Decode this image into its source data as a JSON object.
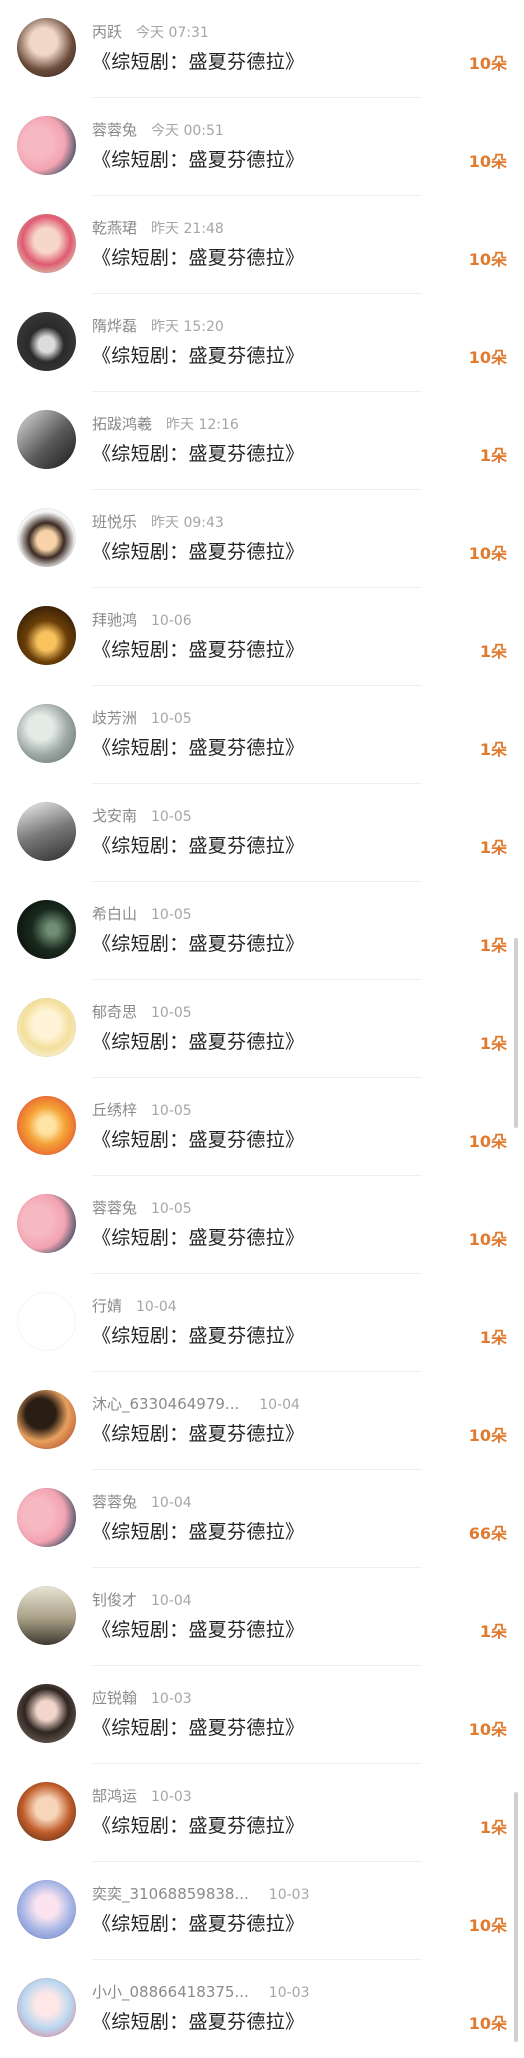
{
  "colors": {
    "accent": "#e07a2f",
    "name_text": "#8a8a8a",
    "title_text": "#222222",
    "divider": "#efefef"
  },
  "items": [
    {
      "name": "丙跃",
      "time": "今天 07:31",
      "title": "《综短剧：盛夏芬德拉》",
      "amount": "10朵"
    },
    {
      "name": "蓉蓉兔",
      "time": "今天 00:51",
      "title": "《综短剧：盛夏芬德拉》",
      "amount": "10朵"
    },
    {
      "name": "乾燕珺",
      "time": "昨天 21:48",
      "title": "《综短剧：盛夏芬德拉》",
      "amount": "10朵"
    },
    {
      "name": "隋烨磊",
      "time": "昨天 15:20",
      "title": "《综短剧：盛夏芬德拉》",
      "amount": "10朵"
    },
    {
      "name": "拓跋鸿羲",
      "time": "昨天 12:16",
      "title": "《综短剧：盛夏芬德拉》",
      "amount": "1朵"
    },
    {
      "name": "班悦乐",
      "time": "昨天 09:43",
      "title": "《综短剧：盛夏芬德拉》",
      "amount": "10朵"
    },
    {
      "name": "拜驰鸿",
      "time": "10-06",
      "title": "《综短剧：盛夏芬德拉》",
      "amount": "1朵"
    },
    {
      "name": "歧芳洲",
      "time": "10-05",
      "title": "《综短剧：盛夏芬德拉》",
      "amount": "1朵"
    },
    {
      "name": "戈安南",
      "time": "10-05",
      "title": "《综短剧：盛夏芬德拉》",
      "amount": "1朵"
    },
    {
      "name": "希白山",
      "time": "10-05",
      "title": "《综短剧：盛夏芬德拉》",
      "amount": "1朵"
    },
    {
      "name": "郁奇思",
      "time": "10-05",
      "title": "《综短剧：盛夏芬德拉》",
      "amount": "1朵"
    },
    {
      "name": "丘绣梓",
      "time": "10-05",
      "title": "《综短剧：盛夏芬德拉》",
      "amount": "10朵"
    },
    {
      "name": "蓉蓉兔",
      "time": "10-05",
      "title": "《综短剧：盛夏芬德拉》",
      "amount": "10朵"
    },
    {
      "name": "行婧",
      "time": "10-04",
      "title": "《综短剧：盛夏芬德拉》",
      "amount": "1朵"
    },
    {
      "name": "沐心_6330464979...",
      "time": "10-04",
      "title": "《综短剧：盛夏芬德拉》",
      "amount": "10朵"
    },
    {
      "name": "蓉蓉兔",
      "time": "10-04",
      "title": "《综短剧：盛夏芬德拉》",
      "amount": "66朵"
    },
    {
      "name": "钊俊才",
      "time": "10-04",
      "title": "《综短剧：盛夏芬德拉》",
      "amount": "1朵"
    },
    {
      "name": "应锐翰",
      "time": "10-03",
      "title": "《综短剧：盛夏芬德拉》",
      "amount": "10朵"
    },
    {
      "name": "郜鸿运",
      "time": "10-03",
      "title": "《综短剧：盛夏芬德拉》",
      "amount": "1朵"
    },
    {
      "name": "奕奕_31068859838...",
      "time": "10-03",
      "title": "《综短剧：盛夏芬德拉》",
      "amount": "10朵"
    },
    {
      "name": "小小_08866418375...",
      "time": "10-03",
      "title": "《综短剧：盛夏芬德拉》",
      "amount": "10朵"
    }
  ]
}
